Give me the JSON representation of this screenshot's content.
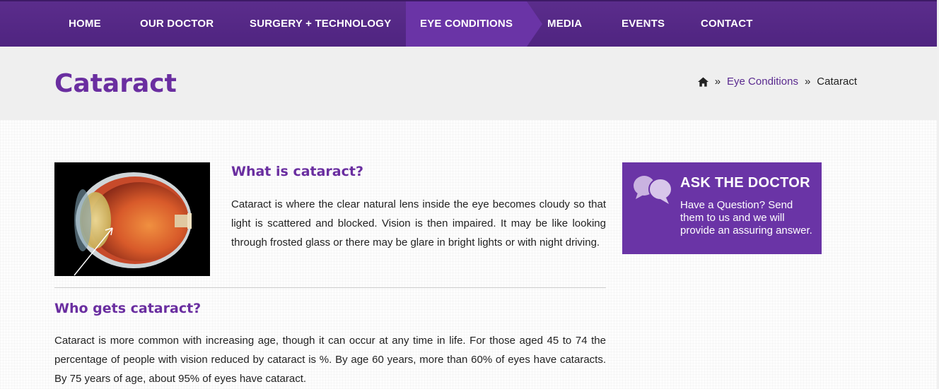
{
  "nav": {
    "items": [
      {
        "label": "HOME"
      },
      {
        "label": "OUR DOCTOR"
      },
      {
        "label": "SURGERY + TECHNOLOGY"
      },
      {
        "label": "EYE CONDITIONS",
        "active": true
      },
      {
        "label": "MEDIA"
      },
      {
        "label": "EVENTS"
      },
      {
        "label": "CONTACT"
      }
    ]
  },
  "header": {
    "title": "Cataract",
    "breadcrumb": {
      "home_icon": "home-icon",
      "separator": "»",
      "parent": "Eye Conditions",
      "current": "Cataract"
    }
  },
  "content": {
    "section1": {
      "title": "What is cataract?",
      "text": "Cataract is where the clear natural lens inside the eye becomes cloudy so that light is scattered and blocked. Vision is then impaired. It may be like looking through frosted glass or there may be glare in bright lights or with night driving."
    },
    "section2": {
      "title": "Who gets cataract?",
      "text": "Cataract is more common with increasing age, though it can occur at any time in life. For those aged 45 to 74 the percentage of people with vision reduced by cataract is %. By age 60 years, more than 60% of eyes have cataracts. By 75 years of age, about 95% of eyes have cataract."
    }
  },
  "sidebar": {
    "ask": {
      "icon": "speech-bubbles-icon",
      "title": "ASK THE DOCTOR",
      "text": "Have a Question? Send them to us and we will provide an assuring answer."
    }
  },
  "colors": {
    "brand_purple": "#6a2ea0",
    "nav_bg": "#5b2d8c",
    "nav_active": "#6a34a6"
  }
}
